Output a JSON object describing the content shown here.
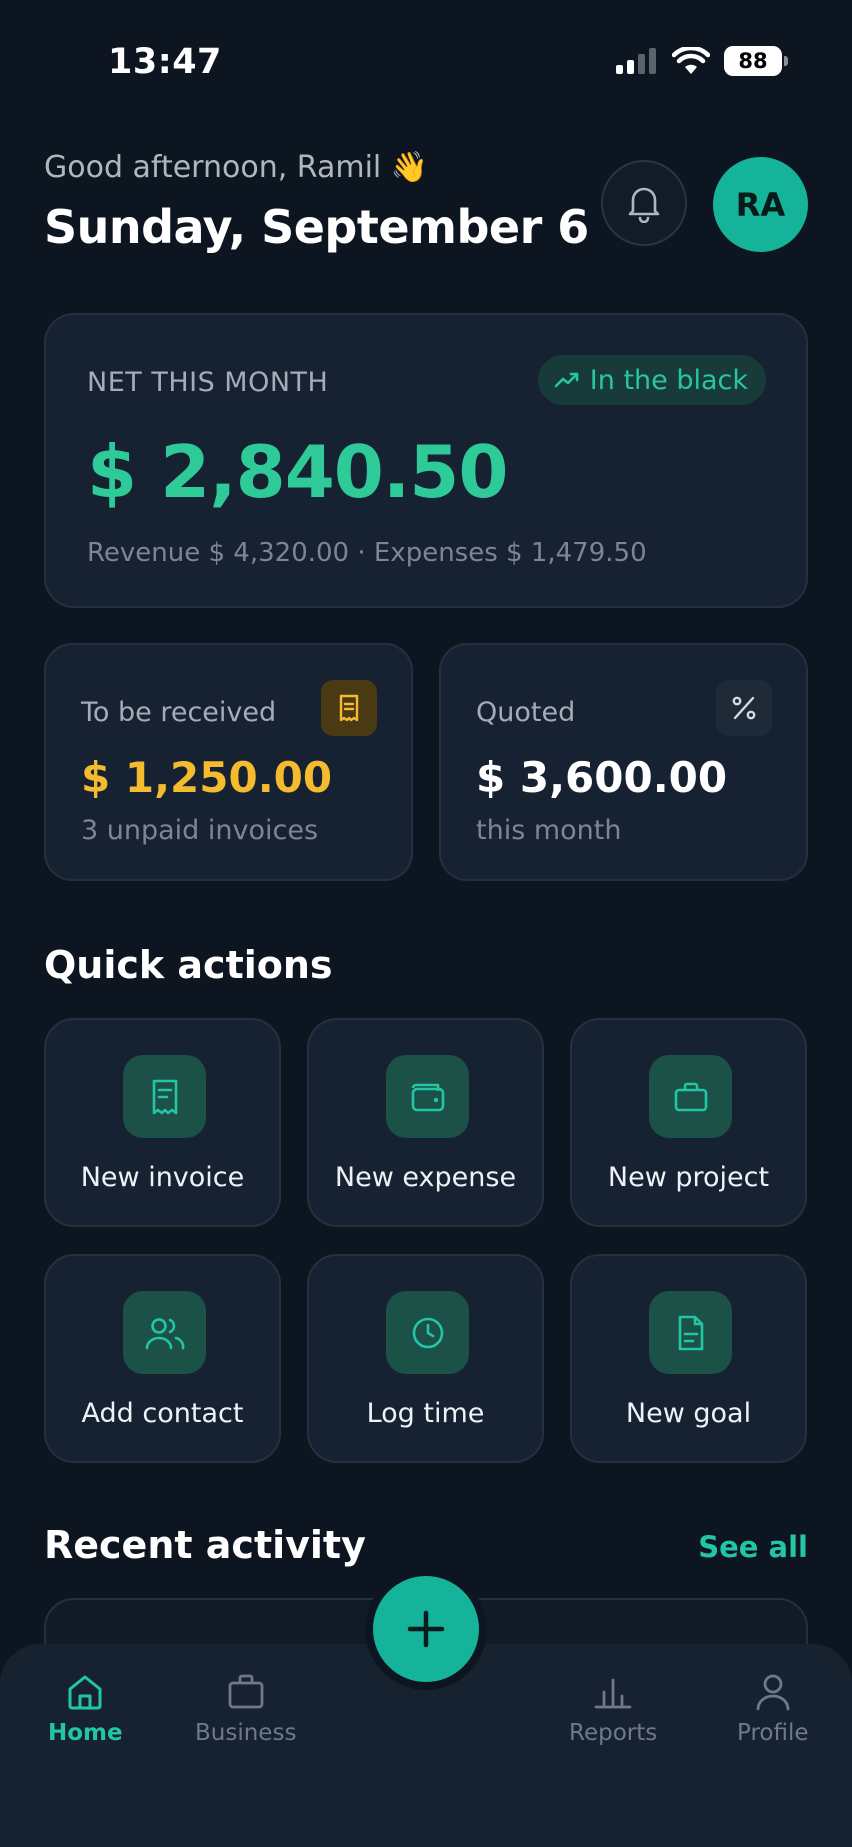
{
  "status_bar": {
    "time": "13:47",
    "battery": "88",
    "icons": [
      "signal-icon",
      "wifi-icon",
      "battery-icon"
    ]
  },
  "header": {
    "greeting": "Good afternoon, Ramil 👋",
    "date": "Sunday, September 6",
    "avatar_initials": "RA",
    "icons": [
      "bell-icon"
    ]
  },
  "net_card": {
    "label": "NET THIS MONTH",
    "badge": "In the black",
    "amount": "$ 2,840.50",
    "summary": "Revenue $ 4,320.00 · Expenses $ 1,479.50"
  },
  "stats": [
    {
      "label": "To be received",
      "amount": "$ 1,250.00",
      "sub": "3 unpaid invoices",
      "icon": "receipt-icon",
      "color": "#f4bb2f"
    },
    {
      "label": "Quoted",
      "amount": "$ 3,600.00",
      "sub": "this month",
      "icon": "percent-icon",
      "color": "#ffffff"
    }
  ],
  "quick_actions": {
    "title": "Quick actions",
    "items": [
      {
        "label": "New invoice",
        "icon": "invoice-icon"
      },
      {
        "label": "New expense",
        "icon": "wallet-icon"
      },
      {
        "label": "New project",
        "icon": "briefcase-icon"
      },
      {
        "label": "Add contact",
        "icon": "contacts-icon"
      },
      {
        "label": "Log time",
        "icon": "clock-icon"
      },
      {
        "label": "New goal",
        "icon": "document-icon"
      }
    ]
  },
  "recent_activity": {
    "title": "Recent activity",
    "see_all": "See all"
  },
  "bottom_nav": {
    "items": [
      {
        "label": "Home",
        "icon": "home-icon",
        "active": true
      },
      {
        "label": "Business",
        "icon": "briefcase-icon",
        "active": false
      },
      {
        "label": "Reports",
        "icon": "bar-chart-icon",
        "active": false
      },
      {
        "label": "Profile",
        "icon": "user-icon",
        "active": false
      }
    ],
    "fab_icon": "plus-icon"
  },
  "colors": {
    "background": "#0d1520",
    "card": "#162131",
    "accent": "#14b39a",
    "positive": "#2ecb98",
    "warning": "#f4bb2f"
  }
}
